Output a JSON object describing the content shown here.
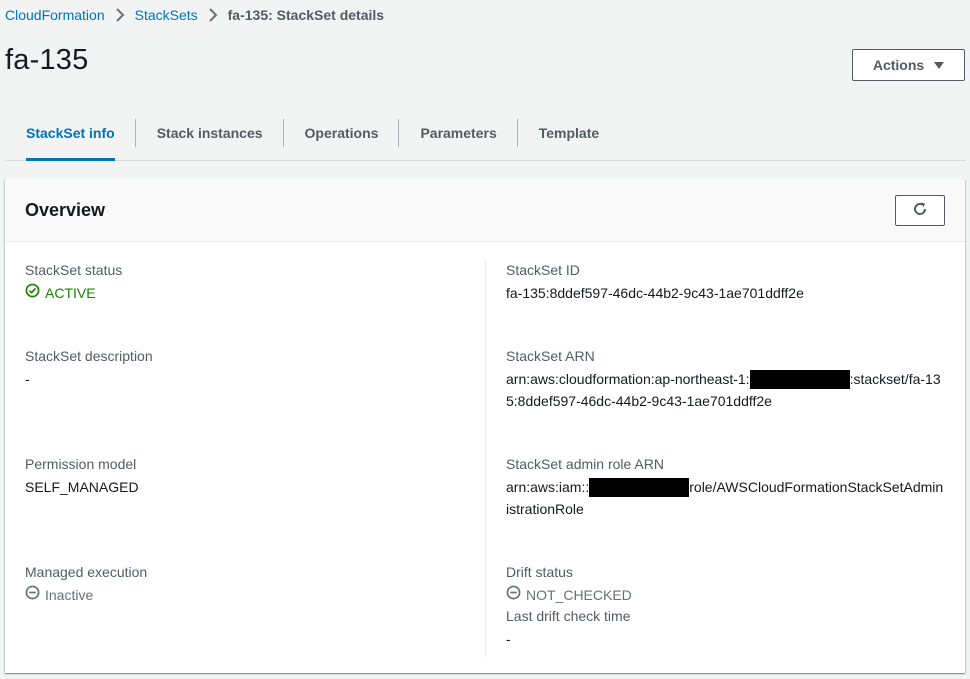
{
  "breadcrumb": {
    "items": [
      "CloudFormation",
      "StackSets"
    ],
    "current": "fa-135: StackSet details"
  },
  "page": {
    "title": "fa-135",
    "actions_label": "Actions"
  },
  "tabs": [
    {
      "label": "StackSet info",
      "active": true
    },
    {
      "label": "Stack instances",
      "active": false
    },
    {
      "label": "Operations",
      "active": false
    },
    {
      "label": "Parameters",
      "active": false
    },
    {
      "label": "Template",
      "active": false
    }
  ],
  "overview": {
    "title": "Overview",
    "refresh_icon": "refresh-icon",
    "left": {
      "status_label": "StackSet status",
      "status_value": "ACTIVE",
      "description_label": "StackSet description",
      "description_value": "-",
      "permission_label": "Permission model",
      "permission_value": "SELF_MANAGED",
      "managed_label": "Managed execution",
      "managed_value": "Inactive"
    },
    "right": {
      "id_label": "StackSet ID",
      "id_value": "fa-135:8ddef597-46dc-44b2-9c43-1ae701ddff2e",
      "arn_label": "StackSet ARN",
      "arn_prefix": "arn:aws:cloudformation:ap-northeast-1:",
      "arn_suffix": ":stackset/fa-135:8ddef597-46dc-44b2-9c43-1ae701ddff2e",
      "role_label": "StackSet admin role ARN",
      "role_prefix": "arn:aws:iam::",
      "role_suffix": "role/AWSCloudFormationStackSetAdministrationRole",
      "drift_label": "Drift status",
      "drift_value": "NOT_CHECKED",
      "last_drift_label": "Last drift check time",
      "last_drift_value": "-"
    }
  },
  "colors": {
    "link": "#0073bb",
    "success": "#1d8102",
    "muted": "#687078"
  }
}
